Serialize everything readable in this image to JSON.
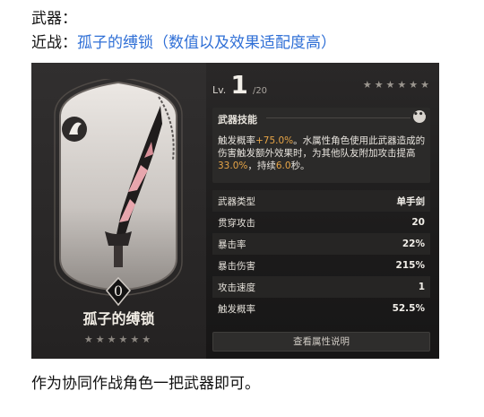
{
  "doc": {
    "line1": "武器：",
    "line2_prefix": "近战：",
    "line2_link": "孤子的缚锁（数值以及效果适配度高）",
    "bottom": "作为协同作战角色一把武器即可。"
  },
  "weapon": {
    "name": "孤子的缚锁",
    "card_stars": "★★★★★★",
    "level_prefix": "Lv.",
    "level": "1",
    "level_max": "/20",
    "stars": "★★★★★★",
    "element_icon": "flame-emblem-icon",
    "rank_icon": "zero-rank-icon"
  },
  "skill": {
    "title": "武器技能",
    "more": "•••",
    "seg1": "触发概率",
    "seg2": "+75.0%",
    "seg3": "。水属性角色使用此武器造成的伤害触发额外效果时，为其他队友附加攻击提高",
    "seg4": "33.0%",
    "seg5": "，持续",
    "seg6": "6.0",
    "seg7": "秒。"
  },
  "stats": [
    {
      "label": "武器类型",
      "value": "单手剑"
    },
    {
      "label": "贯穿攻击",
      "value": "20"
    },
    {
      "label": "暴击率",
      "value": "22%"
    },
    {
      "label": "暴击伤害",
      "value": "215%"
    },
    {
      "label": "攻击速度",
      "value": "1"
    },
    {
      "label": "触发概率",
      "value": "52.5%"
    }
  ],
  "detail_button": "查看属性说明",
  "colors": {
    "link": "#2f6fd6",
    "highlight": "#e8a547",
    "panel_bg": "#1c1b1b"
  }
}
